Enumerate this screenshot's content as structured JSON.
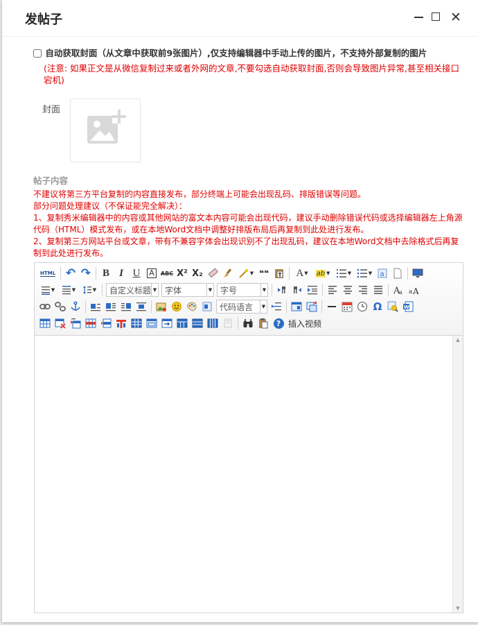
{
  "dialog": {
    "title": "发帖子",
    "icons": {
      "minimize": "minimize-icon",
      "maximize": "maximize-icon",
      "close": "close-icon",
      "close_glyph": "✕"
    }
  },
  "form": {
    "auto_cover_label": "自动获取封面（从文章中获取前9张图片）,仅支持编辑器中手动上传的图片，不支持外部复制的图片",
    "auto_cover_checked": false,
    "auto_cover_warning": "(注意: 如果正文是从微信复制过来或者外网的文章,不要勾选自动获取封面,否则会导致图片异常,甚至相关接口宕机)",
    "cover_label": "封面",
    "cover_icon": "add-image-icon",
    "content_label": "帖子内容",
    "notices": [
      "不建议将第三方平台复制的内容直接发布，部分终端上可能会出现乱码、排版错误等问题。",
      "部分问题处理建议（不保证能完全解决）：",
      "1、复制秀米编辑器中的内容或其他网站的富文本内容可能会出现代码，建议手动删除错误代码或选择编辑器左上角源代码（HTML）模式发布，或在本地Word文档中调整好排版布局后再复制到此处进行发布。",
      "2、复制第三方网站平台或文章，带有不兼容字体会出现识别不了出现乱码，建议在本地Word文档中去除格式后再复制到此处进行发布。"
    ]
  },
  "editor": {
    "toolbar": {
      "source_label": "HTML",
      "glyphs": {
        "undo": "↶",
        "redo": "↷",
        "bold": "B",
        "italic": "I",
        "underline": "U",
        "fontborder": "A",
        "strikethrough": "ABC",
        "superscript": "X²",
        "subscript": "X₂",
        "blockquote": "❝❝",
        "font_color": "A",
        "highlight": "ab",
        "special_char": "Ω",
        "insert_video_icon": "?",
        "dropdown": "▼",
        "scroll_up": "▲",
        "scroll_down": "▼"
      },
      "paragraph_select": "自定义标题",
      "font_family_select": "字体",
      "font_size_select": "字号",
      "code_language_select": "代码语言",
      "insert_video_label": "插入视频"
    }
  },
  "colors": {
    "warning_red": "#e00000",
    "info_blue": "#2b6cc4"
  }
}
